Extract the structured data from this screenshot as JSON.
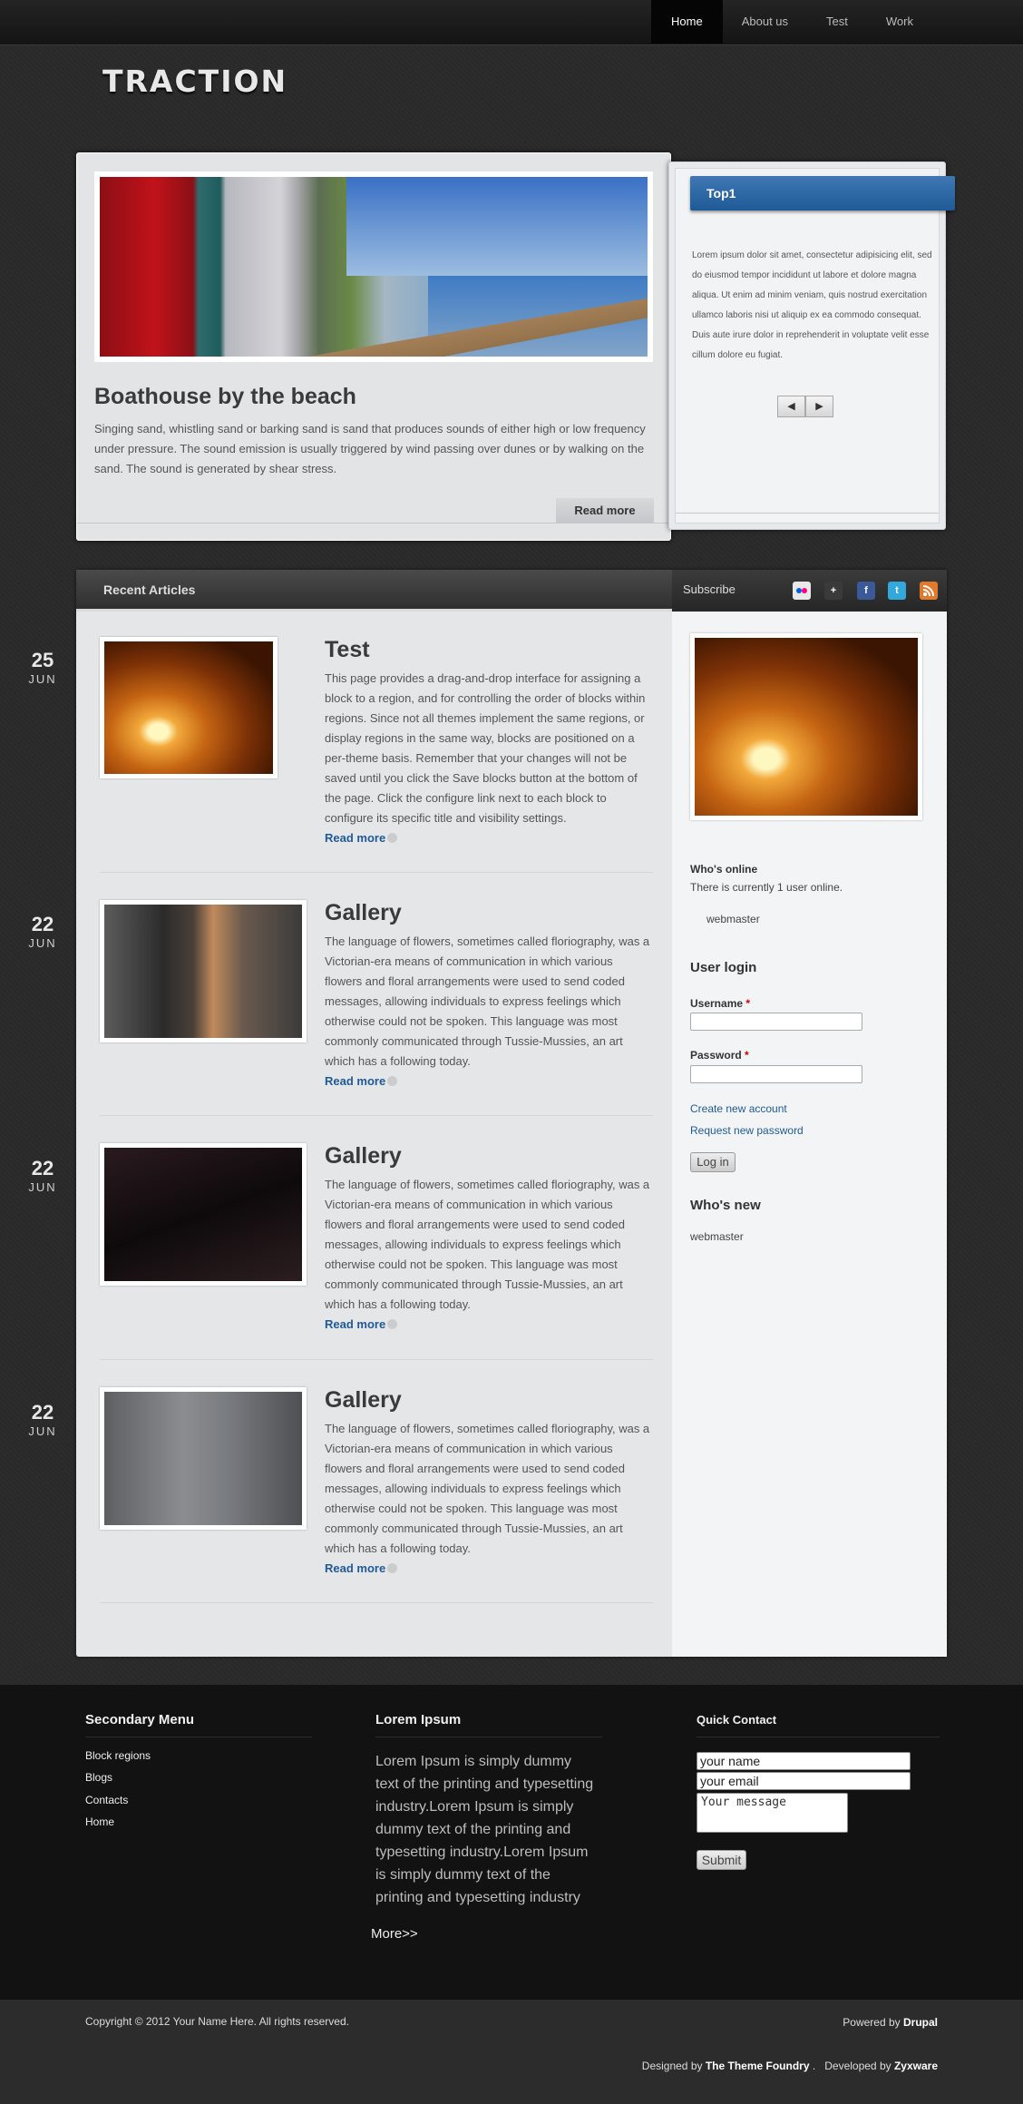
{
  "nav": {
    "items": [
      "Home",
      "About us",
      "Test",
      "Work"
    ]
  },
  "site": {
    "logo": "TRACTION"
  },
  "feature": {
    "title": "Boathouse by the beach",
    "text": "Singing sand, whistling sand or barking sand is sand that produces sounds of either high or low frequency under pressure. The sound emission is usually triggered by wind passing over dunes or by walking on the sand. The sound is generated by shear stress.",
    "readmore": "Read more"
  },
  "top1": {
    "title": "Top1",
    "text": "Lorem ipsum dolor sit amet, consectetur adipisicing elit, sed do eiusmod tempor incididunt ut labore et dolore magna aliqua. Ut enim ad minim veniam, quis nostrud exercitation ullamco laboris nisi ut aliquip ex ea commodo consequat. Duis aute irure dolor in reprehenderit in voluptate velit esse cillum dolore eu fugiat.",
    "prev": "◀",
    "next": "▶"
  },
  "content": {
    "section_title": "Recent Articles",
    "subscribe": "Subscribe"
  },
  "social": [
    "flickr-icon",
    "google-plus-icon",
    "facebook-icon",
    "twitter-icon",
    "rss-icon"
  ],
  "articles": [
    {
      "day": "25",
      "month": "JUN",
      "title": "Test",
      "text": "This page provides a drag-and-drop interface for assigning a block to a region, and for controlling the order of blocks within regions. Since not all themes implement the same regions, or display regions in the same way, blocks are positioned on a per-theme basis. Remember that your changes will not be saved until you click the Save blocks button at the bottom of the page. Click the configure link next to each block to configure its specific title and visibility settings.",
      "more": "Read more"
    },
    {
      "day": "22",
      "month": "JUN",
      "title": "Gallery",
      "text": "The language of flowers, sometimes called floriography, was a Victorian-era means of communication in which various flowers and floral arrangements were used to send coded messages, allowing individuals to express feelings which otherwise could not be spoken. This language was most commonly communicated through Tussie-Mussies, an art which has a following today.",
      "more": "Read more"
    },
    {
      "day": "22",
      "month": "JUN",
      "title": "Gallery",
      "text": "The language of flowers, sometimes called floriography, was a Victorian-era means of communication in which various flowers and floral arrangements were used to send coded messages, allowing individuals to express feelings which otherwise could not be spoken. This language was most commonly communicated through Tussie-Mussies, an art which has a following today.",
      "more": "Read more"
    },
    {
      "day": "22",
      "month": "JUN",
      "title": "Gallery",
      "text": "The language of flowers, sometimes called floriography, was a Victorian-era means of communication in which various flowers and floral arrangements were used to send coded messages, allowing individuals to express feelings which otherwise could not be spoken. This language was most commonly communicated through Tussie-Mussies, an art which has a following today.",
      "more": "Read more"
    }
  ],
  "sidebar": {
    "whos_online_title": "Who's online",
    "whos_online_text": "There is currently 1 user online.",
    "online_user": "webmaster",
    "login_title": "User login",
    "username_label": "Username",
    "password_label": "Password",
    "required_mark": "*",
    "create_account": "Create new account",
    "request_password": "Request new password",
    "login_button": "Log in",
    "whos_new_title": "Who's new",
    "new_user": "webmaster"
  },
  "footer": {
    "secondary_menu_title": "Secondary Menu",
    "secondary_menu": [
      "Block regions",
      "Blogs",
      "Contacts",
      "Home"
    ],
    "lorem_title": "Lorem Ipsum",
    "lorem_text": "Lorem Ipsum is simply dummy text of the printing and typesetting industry.Lorem Ipsum is simply dummy text of the printing and typesetting industry.Lorem Ipsum is simply dummy text of the printing and typesetting industry",
    "more": "More>>",
    "contact_title": "Quick Contact",
    "name_value": "your name",
    "email_value": "your email",
    "message_value": "Your message",
    "submit": "Submit"
  },
  "bottom": {
    "copyright": "Copyright © 2012 Your Name Here. All rights reserved.",
    "powered_prefix": "Powered by",
    "powered_name": "Drupal",
    "designed_prefix": "Designed by",
    "designed_name": "The Theme Foundry",
    "separator": ".",
    "developed_prefix": "Developed by",
    "developed_name": "Zyxware"
  },
  "colors": {
    "accent_blue": "#1f5a96",
    "background": "#2a2a2a",
    "footer": "#121212"
  }
}
